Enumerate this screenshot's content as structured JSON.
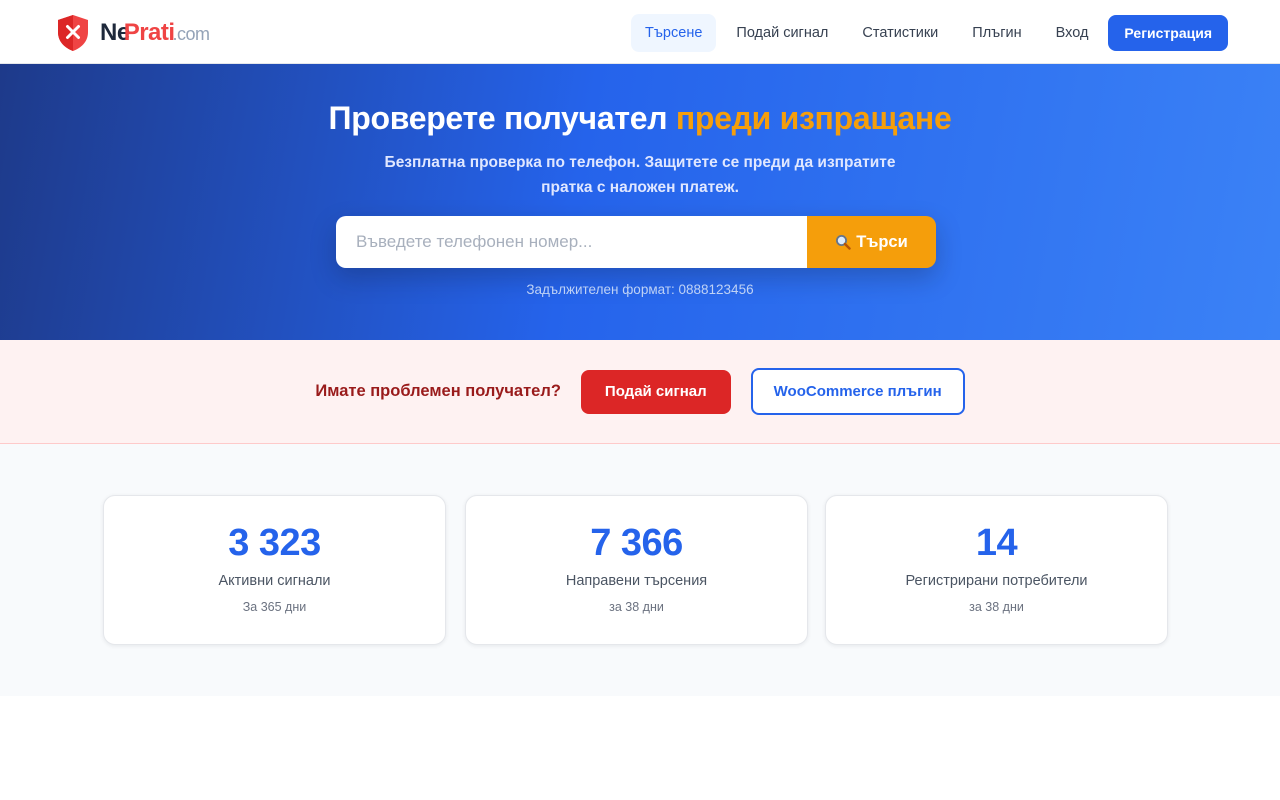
{
  "brand": {
    "logo_icon": "shield-x-icon",
    "name_part1": "Ne",
    "name_part2": "Prati",
    "name_part3": ".com",
    "colors": {
      "primary": "#2563eb",
      "accent": "#f59e0b",
      "danger": "#dc2626"
    }
  },
  "nav": {
    "items": [
      {
        "label": "Търсене",
        "active": true
      },
      {
        "label": "Подай сигнал",
        "active": false
      },
      {
        "label": "Статистики",
        "active": false
      },
      {
        "label": "Плъгин",
        "active": false
      },
      {
        "label": "Вход",
        "active": false
      }
    ],
    "register_label": "Регистрация"
  },
  "hero": {
    "title_main": "Проверете получател",
    "title_accent": "преди изпращане",
    "subtitle": "Безплатна проверка по телефон. Защитете се преди да изпратите пратка с наложен платеж.",
    "search": {
      "placeholder": "Въведете телефонен номер...",
      "value": "",
      "button_icon": "magnifier-icon",
      "button_label": "Търси"
    },
    "hint": "Задължителен формат: 0888123456"
  },
  "report": {
    "question": "Имате проблемен получател?",
    "report_button": "Подай сигнал",
    "plugin_button": "WooCommerce плъгин"
  },
  "stats": [
    {
      "value": "3 323",
      "label": "Активни сигнали",
      "period": "За 365 дни"
    },
    {
      "value": "7 366",
      "label": "Направени търсения",
      "period": "за 38 дни"
    },
    {
      "value": "14",
      "label": "Регистрирани потребители",
      "period": "за 38 дни"
    }
  ]
}
